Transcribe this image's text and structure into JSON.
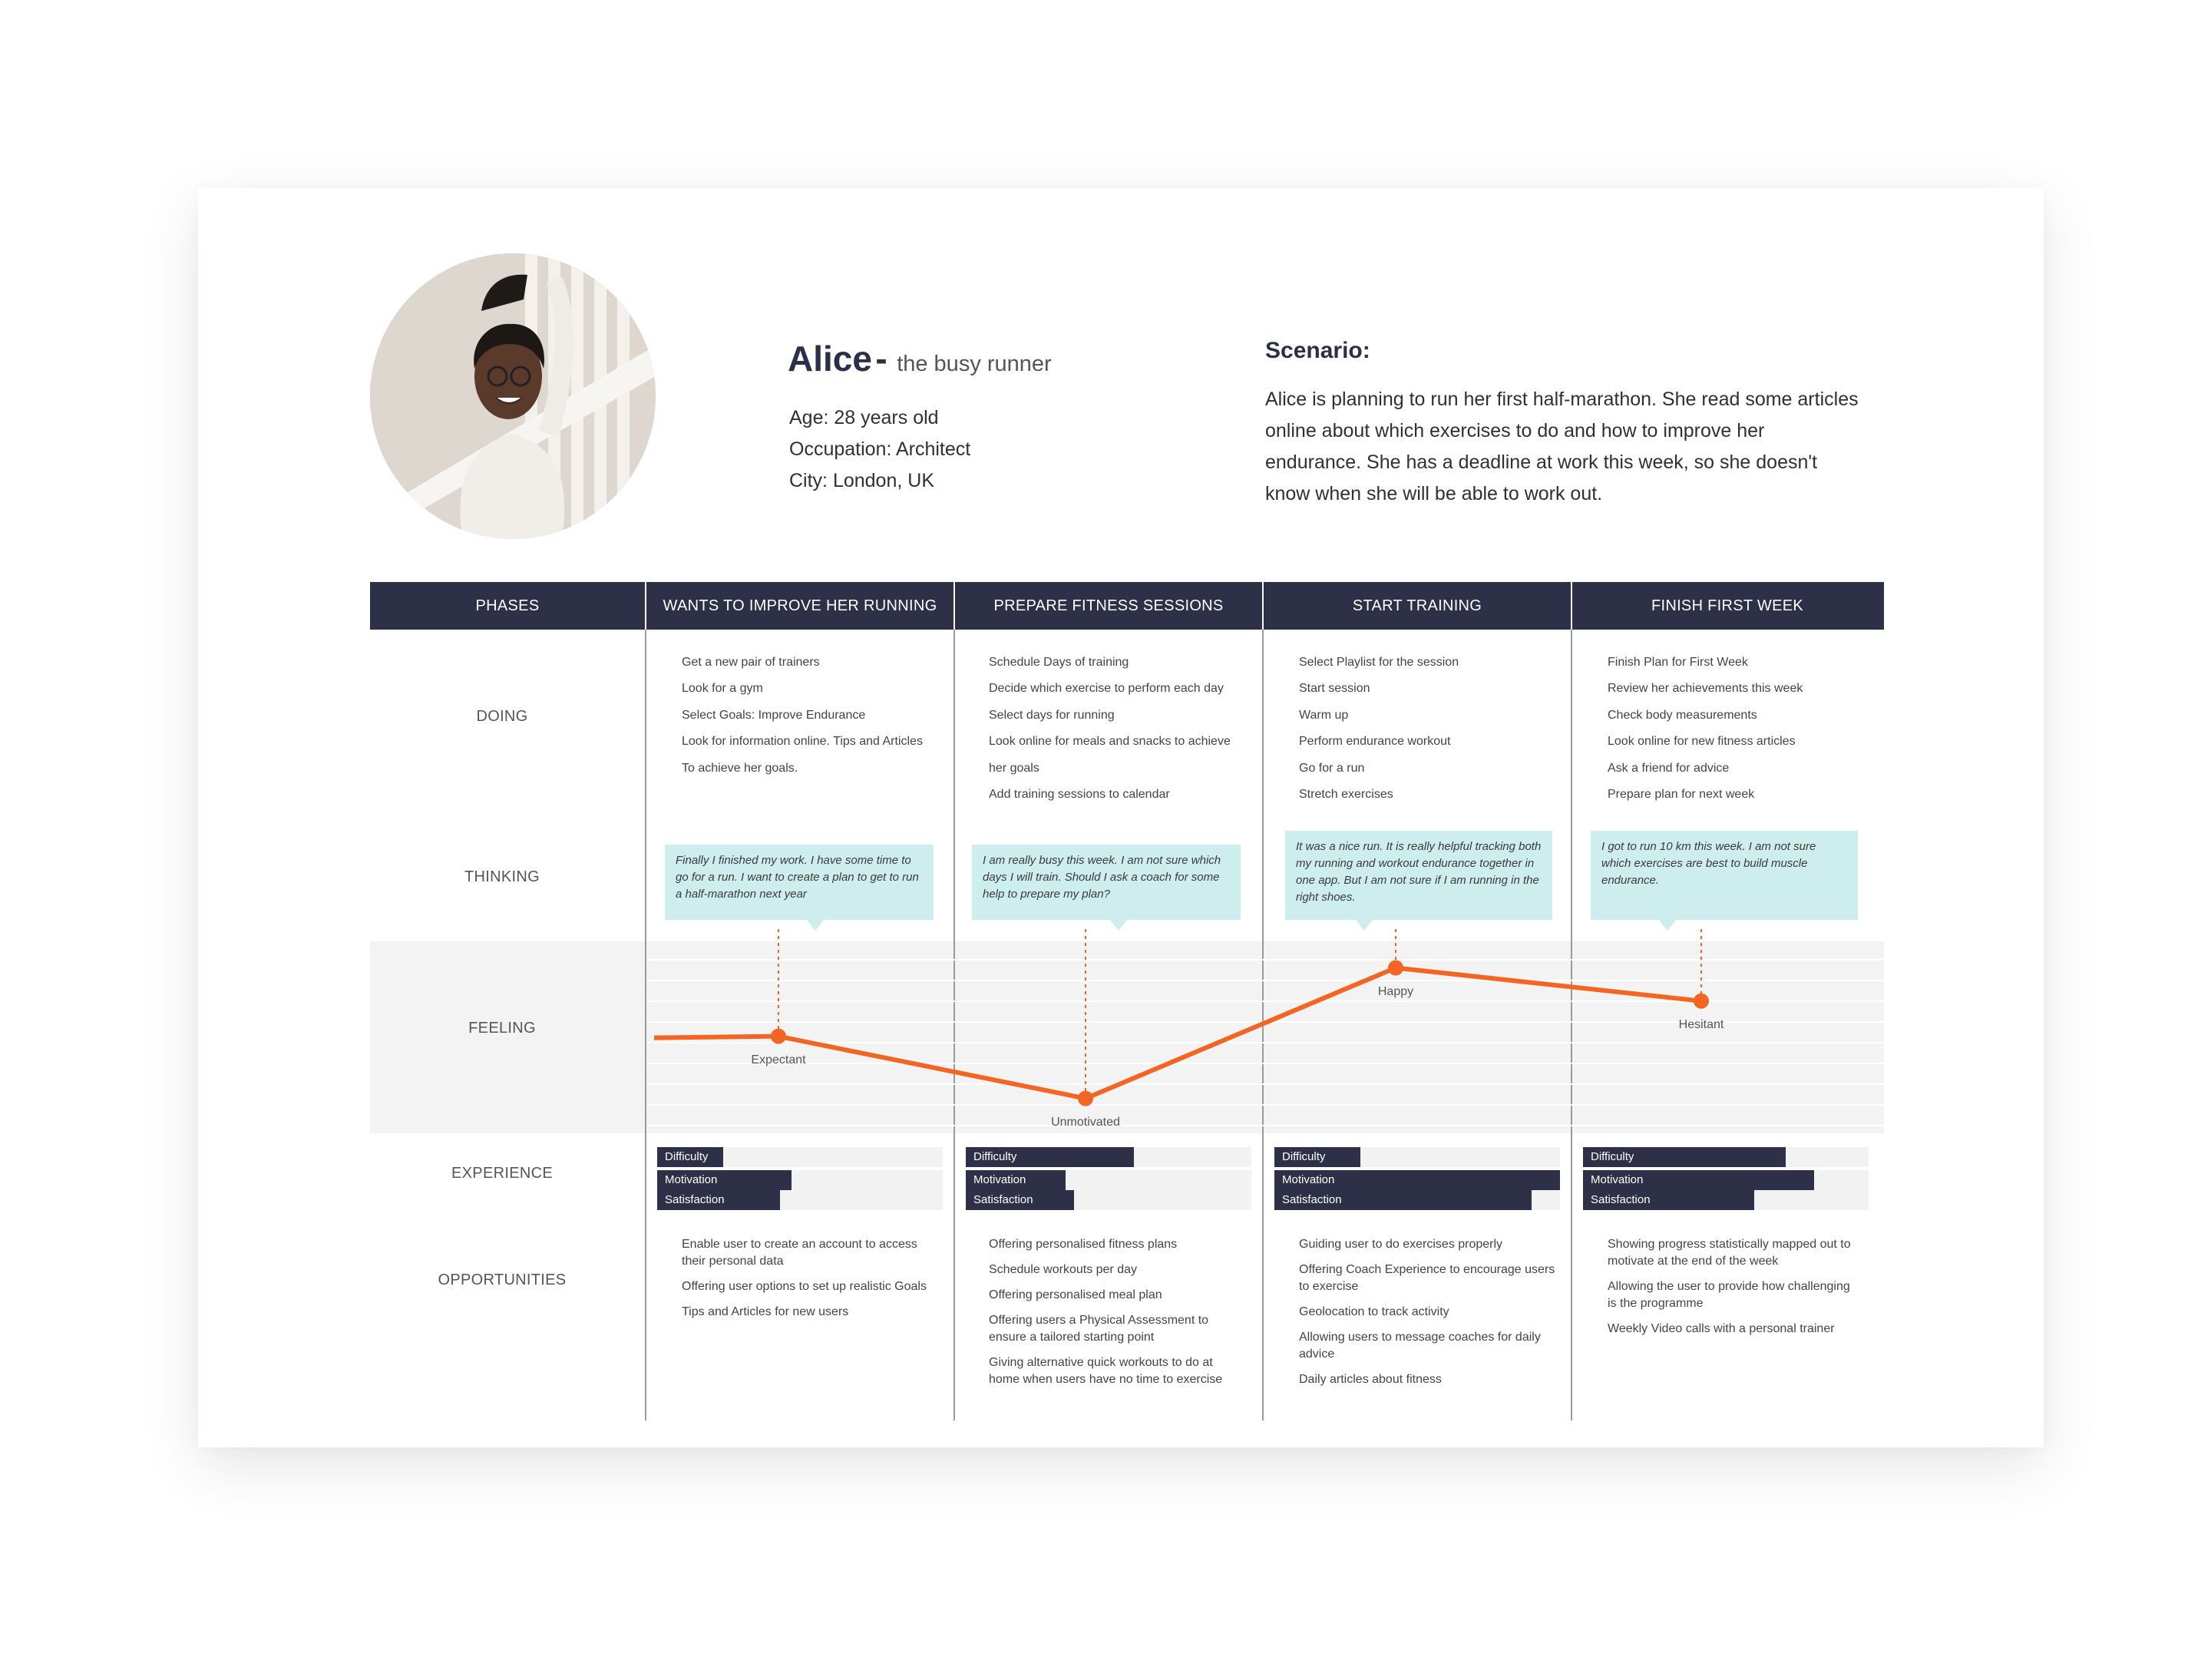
{
  "persona": {
    "name": "Alice",
    "dash": "-",
    "subtitle": "the busy runner",
    "age": "Age: 28 years old",
    "occupation": "Occupation: Architect",
    "city": "City: London, UK"
  },
  "scenario": {
    "title": "Scenario:",
    "text": "Alice is planning to run her first half-marathon. She read some articles online about which exercises to do and how to improve her endurance. She has a deadline at work this week, so she doesn't know when she will be able to work out."
  },
  "rows": {
    "phases": "PHASES",
    "doing": "DOING",
    "thinking": "THINKING",
    "feeling": "FEELING",
    "experience": "EXPERIENCE",
    "opportunities": "OPPORTUNITIES"
  },
  "phases": [
    {
      "title": "WANTS TO IMPROVE HER RUNNING",
      "doing": [
        "Get a new pair of trainers",
        "Look for a gym",
        "Select Goals: Improve Endurance",
        "Look for information online. Tips and Articles",
        "To achieve her goals."
      ],
      "thinking": "Finally I finished my work. I have some time to go for a run. I want to create a plan to get to run a half-marathon next year",
      "feeling": {
        "label": "Expectant",
        "level": 0.52
      },
      "experience": {
        "difficulty": 0.23,
        "motivation": 0.47,
        "satisfaction": 0.43
      },
      "opportunities": [
        "Enable user to create an account to access their personal data",
        "Offering user options to set up realistic Goals",
        "Tips and Articles for new users"
      ]
    },
    {
      "title": "PREPARE FITNESS SESSIONS",
      "doing": [
        "Schedule Days of training",
        "Decide which exercise to perform each day",
        "Select days for running",
        "Look online for meals and snacks to achieve her goals",
        "Add training sessions to calendar"
      ],
      "thinking": "I am really busy this week. I am not sure which days I will train. Should I ask a coach for some help to prepare my plan?",
      "feeling": {
        "label": "Unmotivated",
        "level": 0.22
      },
      "experience": {
        "difficulty": 0.59,
        "motivation": 0.35,
        "satisfaction": 0.38
      },
      "opportunities": [
        "Offering personalised fitness plans",
        "Schedule workouts per day",
        "Offering personalised meal plan",
        "Offering users a Physical Assessment to ensure a tailored starting point",
        "Giving alternative quick workouts to do at home when users have no time to exercise"
      ]
    },
    {
      "title": "START TRAINING",
      "doing": [
        "Select Playlist for the session",
        "Start session",
        "Warm up",
        "Perform endurance workout",
        "Go for a run",
        "Stretch exercises"
      ],
      "thinking": "It was a nice run. It is really helpful tracking both my running and workout endurance together in one app. But I am not sure if I am running in  the right shoes.",
      "feeling": {
        "label": "Happy",
        "level": 0.85
      },
      "experience": {
        "difficulty": 0.3,
        "motivation": 1.0,
        "satisfaction": 0.9
      },
      "opportunities": [
        "Guiding user to do exercises properly",
        "Offering Coach Experience to encourage users to exercise",
        "Geolocation to track activity",
        "Allowing users to message coaches for daily advice",
        "Daily articles about fitness"
      ]
    },
    {
      "title": "FINISH FIRST WEEK",
      "doing": [
        "Finish Plan for First Week",
        "Review her achievements this week",
        "Check body measurements",
        "Look online for new fitness articles",
        "Ask a friend for advice",
        "Prepare plan for next week"
      ],
      "thinking": "I got to run 10 km this week. I am not sure which exercises are best to build muscle endurance.",
      "feeling": {
        "label": "Hesitant",
        "level": 0.69
      },
      "experience": {
        "difficulty": 0.71,
        "motivation": 0.81,
        "satisfaction": 0.6
      },
      "opportunities": [
        "Showing progress statistically mapped out to motivate at the end of the week",
        "Allowing the user to provide how challenging is the programme",
        "Weekly Video calls with a personal trainer"
      ]
    }
  ],
  "experience_labels": {
    "difficulty": "Difficulty",
    "motivation": "Motivation",
    "satisfaction": "Satisfaction"
  },
  "colors": {
    "navy": "#2d3047",
    "orange": "#f26522",
    "bubble": "#cdeeed"
  }
}
